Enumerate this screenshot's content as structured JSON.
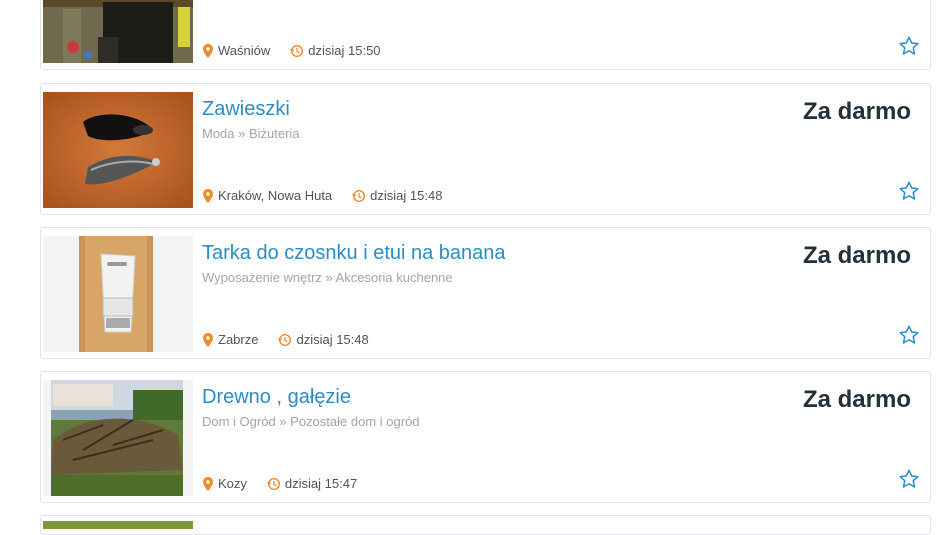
{
  "colors": {
    "title": "#2a8dc6",
    "price": "#23313b",
    "accent_icon": "#f08a2b",
    "star": "#2a8dc6",
    "category": "#9fa6ab"
  },
  "listings": [
    {
      "title": "",
      "category": "",
      "price": "",
      "location": "Waśniów",
      "time": "dzisiaj 15:50"
    },
    {
      "title": "Zawieszki",
      "category": "Moda » Biżuteria",
      "price": "Za darmo",
      "location": "Kraków, Nowa Huta",
      "time": "dzisiaj 15:48"
    },
    {
      "title": "Tarka do czosnku i etui na banana",
      "category": "Wyposażenie wnętrz » Akcesoria kuchenne",
      "price": "Za darmo",
      "location": "Zabrze",
      "time": "dzisiaj 15:48"
    },
    {
      "title": "Drewno , gałęzie",
      "category": "Dom i Ogród » Pozostałe dom i ogród",
      "price": "Za darmo",
      "location": "Kozy",
      "time": "dzisiaj 15:47"
    }
  ],
  "icons": {
    "location": "map-pin-icon",
    "time": "clock-history-icon",
    "favorite": "star-outline-icon"
  }
}
